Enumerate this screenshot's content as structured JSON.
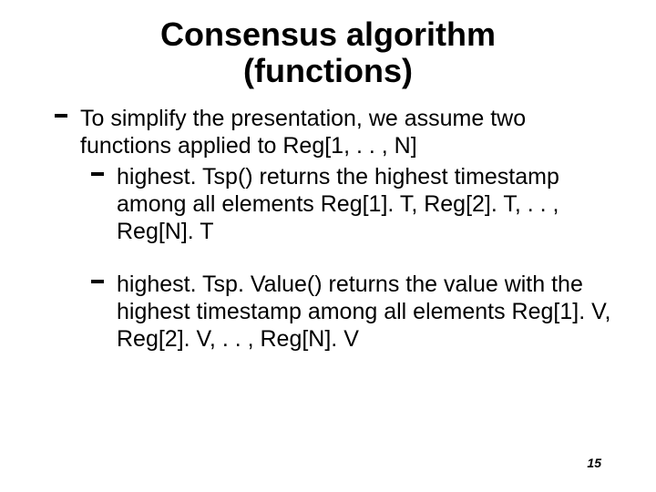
{
  "title_line1": "Consensus algorithm",
  "title_line2": "(functions)",
  "bullets": {
    "b1": "To simplify the presentation, we assume two functions applied to Reg[1, . . , N]",
    "sub1": "highest. Tsp() returns the highest timestamp among all elements Reg[1]. T, Reg[2]. T, . . , Reg[N]. T",
    "sub2": "highest. Tsp. Value() returns the value with the highest timestamp among all elements Reg[1]. V, Reg[2]. V, . . , Reg[N]. V"
  },
  "page_number": "15"
}
